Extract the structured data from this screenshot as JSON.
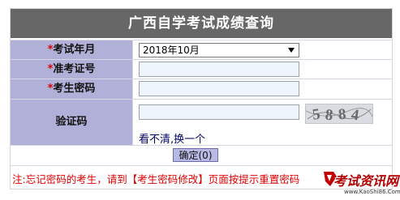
{
  "title": "广西自学考试成绩查询",
  "form": {
    "exam_date_label": "考试年月",
    "exam_date_value": "2018年10月",
    "ticket_label": "准考证号",
    "ticket_value": "",
    "password_label": "考生密码",
    "password_value": "",
    "captcha_label": "验证码",
    "captcha_value": "",
    "captcha_code": "5884",
    "refresh_label": "看不清,换一个",
    "required_mark": "*",
    "submit_label": "确定(0)"
  },
  "note": {
    "prefix": "注:忘记密码的考生，请到【",
    "link": "考生密码修改",
    "suffix": "】页面按提示重置密码"
  },
  "watermark": {
    "text": "考试资讯网",
    "url": "www.KaoShi86.Com"
  },
  "colors": {
    "title_bg": "#676767",
    "label_bg": "#b0b0d8",
    "required_star": "#e00000",
    "note_text": "#e00000",
    "input_bg": "#eef4fb",
    "button_bg": "#b9b9e6"
  },
  "icons": {
    "select_arrow": "chevron-down-icon",
    "watermark_logo": "logo-icon"
  }
}
